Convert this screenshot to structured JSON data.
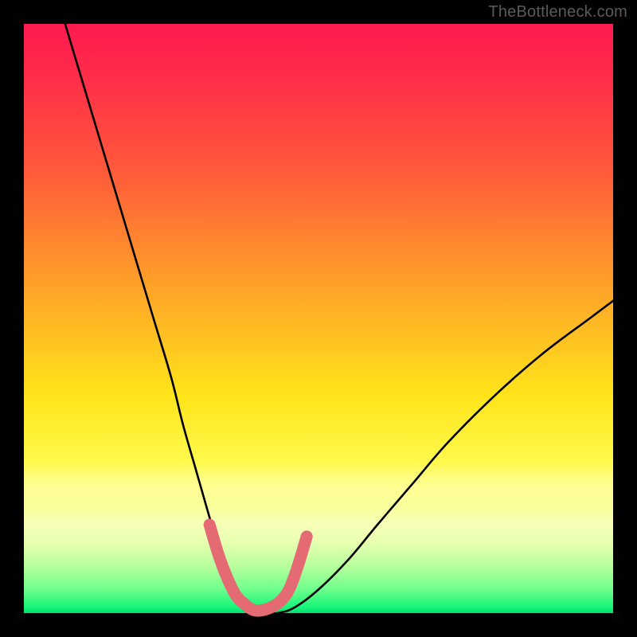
{
  "attribution": "TheBottleneck.com",
  "chart_data": {
    "type": "line",
    "title": "",
    "xlabel": "",
    "ylabel": "",
    "xlim": [
      0,
      100
    ],
    "ylim": [
      0,
      100
    ],
    "grid": false,
    "legend": false,
    "background_gradient": {
      "direction": "vertical",
      "stops": [
        {
          "pos": 0.0,
          "color": "#ff1a50"
        },
        {
          "pos": 0.25,
          "color": "#ff5a3a"
        },
        {
          "pos": 0.5,
          "color": "#ffc420"
        },
        {
          "pos": 0.7,
          "color": "#fff030"
        },
        {
          "pos": 0.88,
          "color": "#e8ffb0"
        },
        {
          "pos": 1.0,
          "color": "#00e070"
        }
      ]
    },
    "series": [
      {
        "name": "bottleneck-curve",
        "stroke": "#000000",
        "x": [
          7,
          10,
          13,
          16,
          19,
          22,
          25,
          27,
          29,
          31,
          32.5,
          34,
          35.5,
          37,
          38.5,
          40,
          43,
          46,
          50,
          55,
          60,
          66,
          72,
          80,
          88,
          96,
          100
        ],
        "y": [
          100,
          90,
          80,
          70,
          60,
          50,
          40,
          32,
          25,
          18,
          13,
          9,
          5,
          2.5,
          1,
          0,
          0,
          1,
          4,
          9,
          15,
          22,
          29,
          37,
          44,
          50,
          53
        ]
      },
      {
        "name": "valley-marker",
        "stroke": "#e46a74",
        "style": "thick-rounded",
        "x": [
          31.5,
          33,
          34.5,
          36,
          37.5,
          39,
          40.5,
          42,
          43.5,
          45,
          46.5,
          48
        ],
        "y": [
          15,
          10,
          6,
          3,
          1.5,
          0.5,
          0.5,
          1,
          2,
          4,
          8,
          13
        ]
      }
    ],
    "annotations": []
  }
}
